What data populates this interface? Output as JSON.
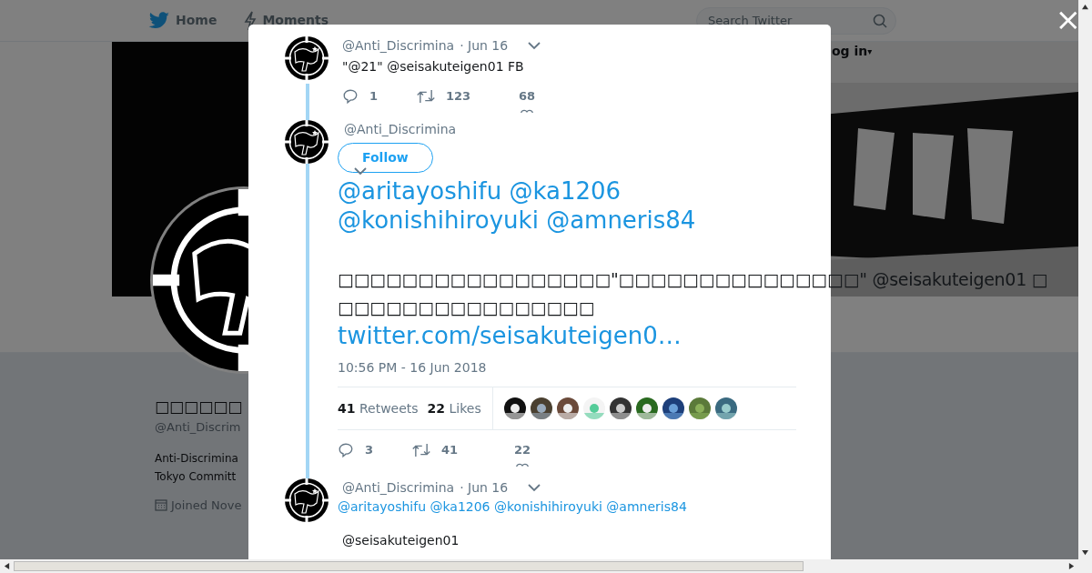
{
  "nav": {
    "items": [
      {
        "label": "Home"
      },
      {
        "label": "Moments"
      }
    ],
    "search": {
      "placeholder": "Search Twitter"
    },
    "login": "og in",
    "login_caret": "▾"
  },
  "profile": {
    "name": "□□□□□□",
    "handle": "@Anti_Discrim",
    "bio_lines": [
      "Anti-Discrimina",
      "Tokyo Committ"
    ],
    "joined": "Joined Nove"
  },
  "modal": {
    "close": "×",
    "tweets": [
      {
        "kind": "reply",
        "handle": "@Anti_Discrimina",
        "date": "· Jun 16",
        "text": "\"@21\" @seisakuteigen01 FB",
        "replies": "1",
        "retweets": "123",
        "likes": "68"
      },
      {
        "kind": "main",
        "handle": "@Anti_Discrimina",
        "follow": "Follow",
        "mentions": "@aritayoshifu @ka1206 @konishihiroyuki @amneris84",
        "body": "□□□□□□□□□□□□□□□□□\"□□□□□□□□□□□□□□□\" @seisakuteigen01 □\n□□□□□□□□□□□□□□□□",
        "link": "twitter.com/seisakuteigen0…",
        "time": "10:56 PM - 16 Jun 2018",
        "retweet_count": "41",
        "retweet_label": "Retweets",
        "like_count": "22",
        "like_label": "Likes",
        "replies": "3",
        "retweets": "41",
        "likes": "22"
      },
      {
        "kind": "reply",
        "handle": "@Anti_Discrimina",
        "date": "· Jun 16",
        "mentions": "@aritayoshifu @ka1206 @konishihiroyuki @amneris84",
        "text": "@seisakuteigen01"
      }
    ]
  }
}
